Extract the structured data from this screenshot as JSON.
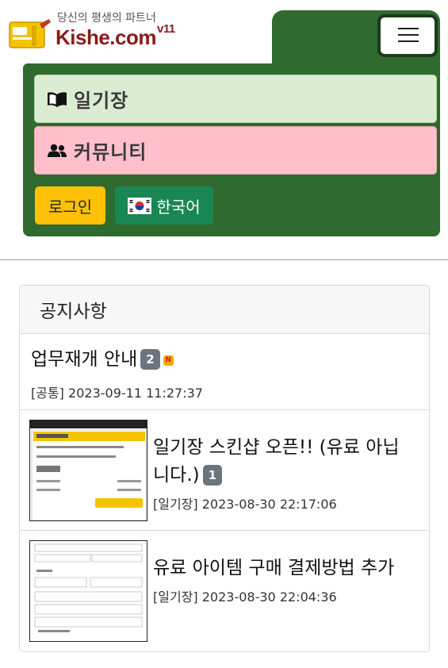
{
  "header": {
    "tagline": "당신의 평생의 파트너",
    "brand": "Kishe.com",
    "version": "v11",
    "menu_icon": "hamburger-menu-icon"
  },
  "nav": {
    "diary_label": "일기장",
    "diary_icon": "book-open-icon",
    "community_label": "커뮤니티",
    "community_icon": "people-icon",
    "login_label": "로그인",
    "language_label": "한국어",
    "language_icon": "korea-flag-icon"
  },
  "notice": {
    "header": "공지사항",
    "items": [
      {
        "title": "업무재개 안내",
        "comments": "2",
        "new_badge": "N",
        "category": "[공통]",
        "datetime": "2023-09-11 11:27:37"
      },
      {
        "title": "일기장 스킨샵 오픈!! (유료 아닙니다.)",
        "comments": "1",
        "category": "[일기장]",
        "datetime": "2023-08-30 22:17:06"
      },
      {
        "title": "유료 아이템 구매 결제방법 추가",
        "category": "[일기장]",
        "datetime": "2023-08-30 22:04:36"
      }
    ]
  },
  "colors": {
    "nav_green": "#2f6a2f",
    "diary_bg": "#dcecd2",
    "community_bg": "#ffc0cb",
    "login_bg": "#ffc107",
    "language_bg": "#198754",
    "brand": "#8b1a1a"
  }
}
